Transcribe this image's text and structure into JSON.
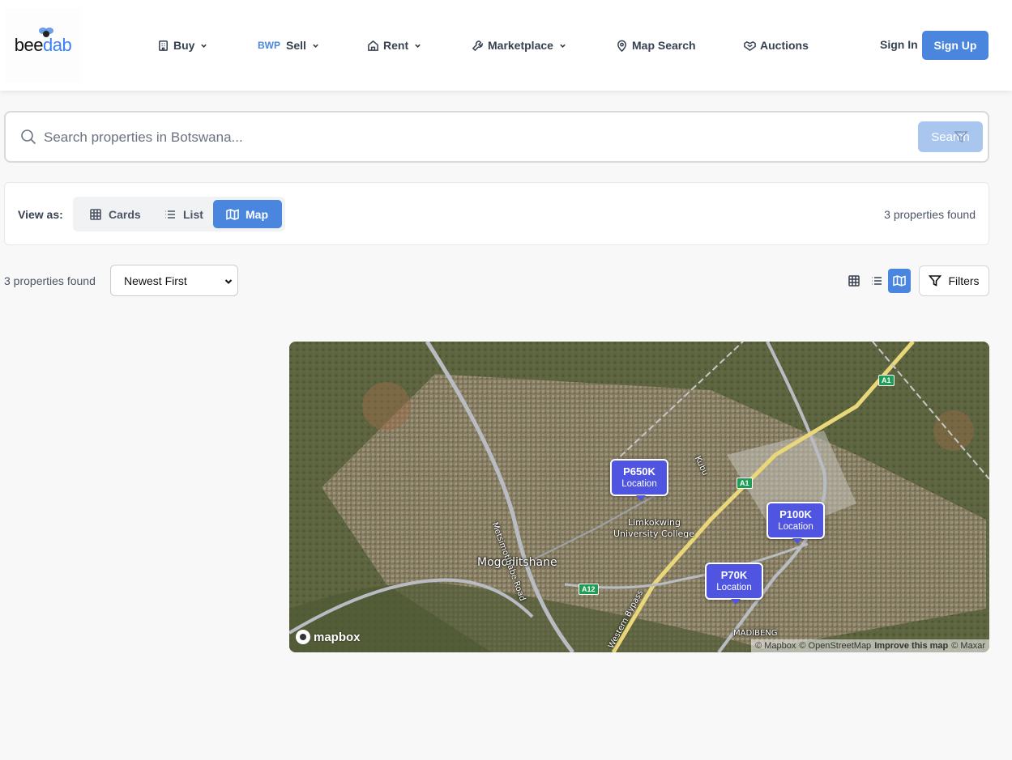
{
  "brand": {
    "logo_text_main": "bee",
    "logo_text_accent": "dab"
  },
  "nav": {
    "items": [
      {
        "label": "Buy",
        "icon": "building-icon",
        "has_dropdown": true
      },
      {
        "label": "Sell",
        "prefix": "BWP",
        "icon": "currency-icon",
        "has_dropdown": true
      },
      {
        "label": "Rent",
        "icon": "home-icon",
        "has_dropdown": true
      },
      {
        "label": "Marketplace",
        "icon": "wrench-icon",
        "has_dropdown": true
      },
      {
        "label": "Map Search",
        "icon": "map-pin-icon",
        "has_dropdown": false
      },
      {
        "label": "Auctions",
        "icon": "handshake-icon",
        "has_dropdown": false
      }
    ],
    "sign_in": "Sign In",
    "sign_up": "Sign Up"
  },
  "search": {
    "placeholder": "Search properties in Botswana...",
    "value": "",
    "button_label": "Search"
  },
  "view_panel": {
    "label": "View as:",
    "options": [
      {
        "label": "Cards",
        "icon": "grid-icon"
      },
      {
        "label": "List",
        "icon": "list-icon"
      },
      {
        "label": "Map",
        "icon": "map-icon"
      }
    ],
    "active": "Map",
    "count_text": "3 properties found"
  },
  "toolbar": {
    "count_text": "3 properties found",
    "sort_selected": "Newest First",
    "filters_label": "Filters",
    "active_view": "map"
  },
  "map": {
    "markers": [
      {
        "price": "P650K",
        "label": "Location"
      },
      {
        "price": "P100K",
        "label": "Location"
      },
      {
        "price": "P70K",
        "label": "Location"
      }
    ],
    "place_labels": {
      "town": "Mogoditshane",
      "college_line1": "Limkokwing",
      "college_line2": "University College",
      "road": "Metsimotlhabe Road",
      "road2": "Kubu",
      "bypass": "Western Bypass",
      "district": "MADIBENG"
    },
    "shields": {
      "a1_top": "A1",
      "a1_mid": "A1",
      "a12": "A12"
    },
    "logo": "mapbox",
    "attribution": {
      "mapbox": "© Mapbox",
      "osm": "© OpenStreetMap",
      "improve": "Improve this map",
      "maxar": "© Maxar"
    }
  },
  "colors": {
    "accent": "#4a86dd",
    "marker": "#4f55e0",
    "search_button": "#a9c6ef"
  }
}
